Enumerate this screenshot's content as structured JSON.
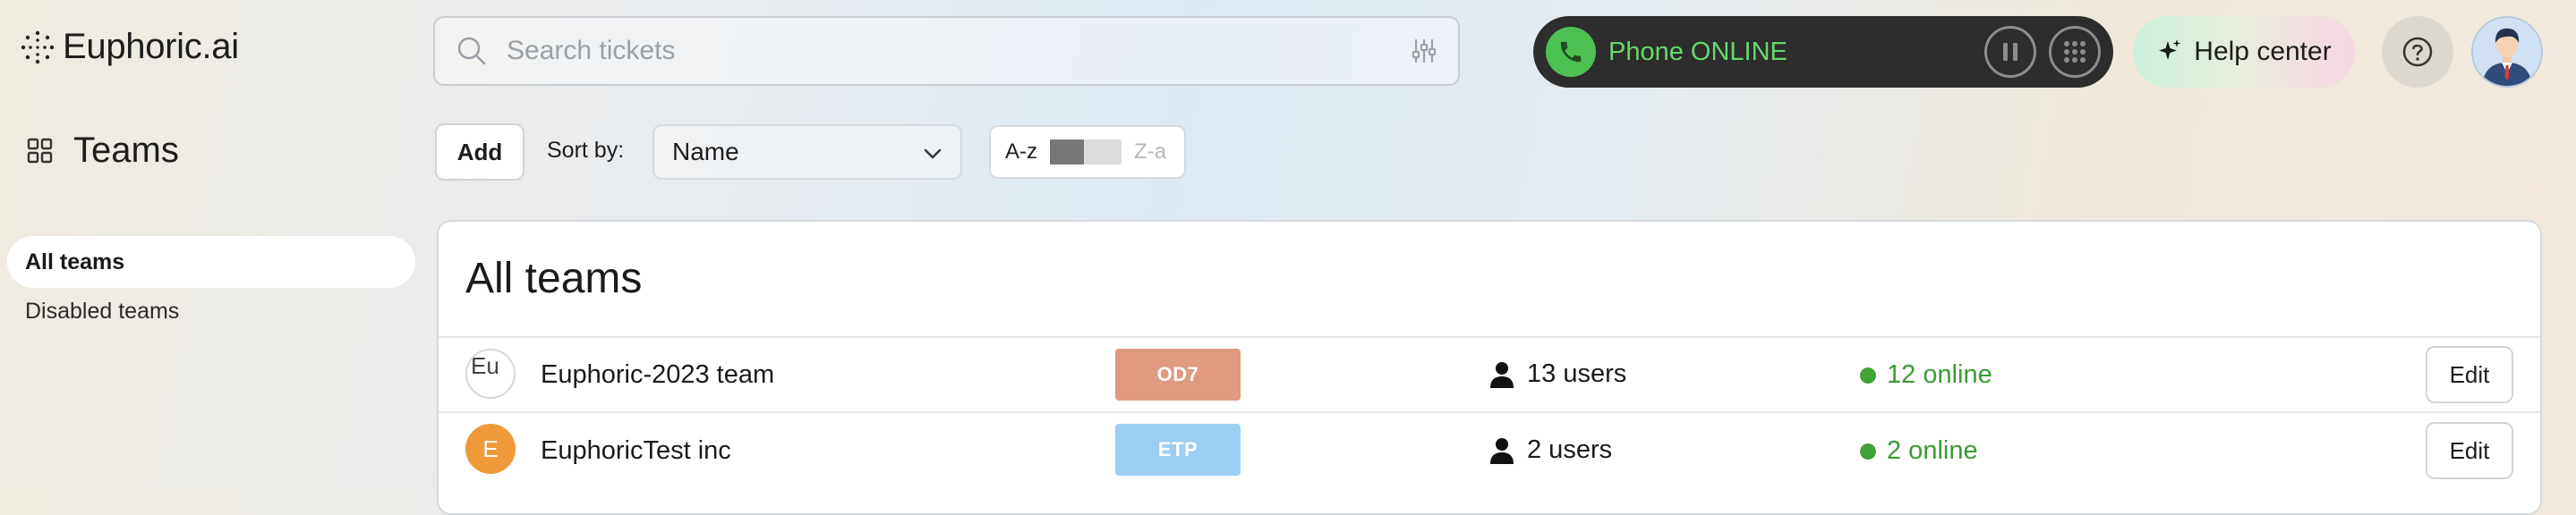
{
  "app": {
    "logo_text": "Euphoric.ai"
  },
  "search": {
    "placeholder": "Search tickets"
  },
  "phone": {
    "status": "Phone ONLINE"
  },
  "help": {
    "label": "Help center"
  },
  "nav": {
    "title": "Teams",
    "items": [
      {
        "label": "All teams",
        "selected": true
      },
      {
        "label": "Disabled teams",
        "selected": false
      }
    ]
  },
  "toolbar": {
    "add_label": "Add",
    "sort_label": "Sort by:",
    "sort_value": "Name",
    "az_label": "A-z",
    "za_label": "Z-a"
  },
  "main": {
    "title": "All teams",
    "rows": [
      {
        "logo_text": "Eu",
        "name": "Euphoric-2023 team",
        "code": "OD7",
        "code_color": "#df9a7f",
        "users": "13 users",
        "online": "12 online",
        "edit_label": "Edit"
      },
      {
        "logo_text": "E",
        "name": "EuphoricTest inc",
        "code": "ETP",
        "code_color": "#9ccdf2",
        "users": "2 users",
        "online": "2 online",
        "edit_label": "Edit"
      }
    ]
  }
}
